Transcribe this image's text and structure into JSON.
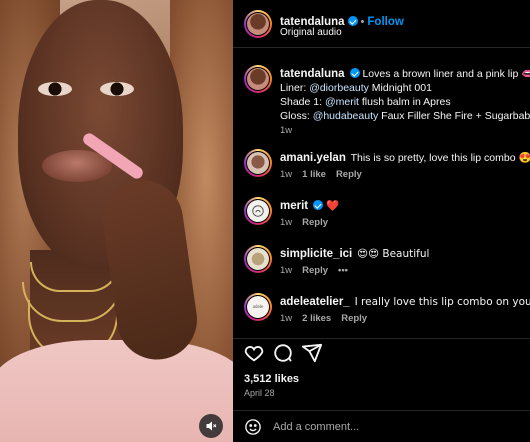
{
  "post": {
    "author": "tatendaluna",
    "follow_label": "Follow",
    "audio": "Original audio",
    "caption": {
      "line1": "Loves a brown liner and a pink lip 👄",
      "line2_prefix": "Liner: ",
      "line2_mention": "@diorbeauty",
      "line2_suffix": " Midnight 001",
      "line3_prefix": "Shade 1: ",
      "line3_mention": "@merit",
      "line3_suffix": " flush balm in Apres",
      "line4_prefix": "Gloss: ",
      "line4_mention": "@hudabeauty",
      "line4_suffix": " Faux Filler She Fire + Sugarbaby",
      "time": "1w"
    }
  },
  "comments": [
    {
      "user": "amani.yelan",
      "verified": false,
      "text": "This is so pretty, love this lip combo 😍",
      "time": "1w",
      "likes": "1 like",
      "reply": "Reply"
    },
    {
      "user": "merit",
      "verified": true,
      "text": "❤️",
      "time": "1w",
      "likes": "",
      "reply": "Reply"
    },
    {
      "user": "simplicite_ici",
      "verified": false,
      "text": "😍😍 Beautiful",
      "time": "1w",
      "likes": "",
      "reply": "Reply",
      "more": "•••"
    },
    {
      "user": "adeleatelier_",
      "verified": false,
      "text": "I really love this lip combo on you! 😍❤️",
      "time": "1w",
      "likes": "2 likes",
      "reply": "Reply"
    }
  ],
  "engagement": {
    "likes": "3,512 likes",
    "date": "April 28"
  },
  "add_comment": {
    "placeholder": "Add a comment..."
  },
  "icons": {
    "like": "heart-icon",
    "comment": "comment-icon",
    "share": "share-icon",
    "mute": "speaker-muted-icon",
    "emoji": "smiley-icon",
    "verified": "verified-badge-icon"
  },
  "colors": {
    "accent": "#0095f6",
    "background": "#000000",
    "secondary_text": "#a8a8a8"
  }
}
